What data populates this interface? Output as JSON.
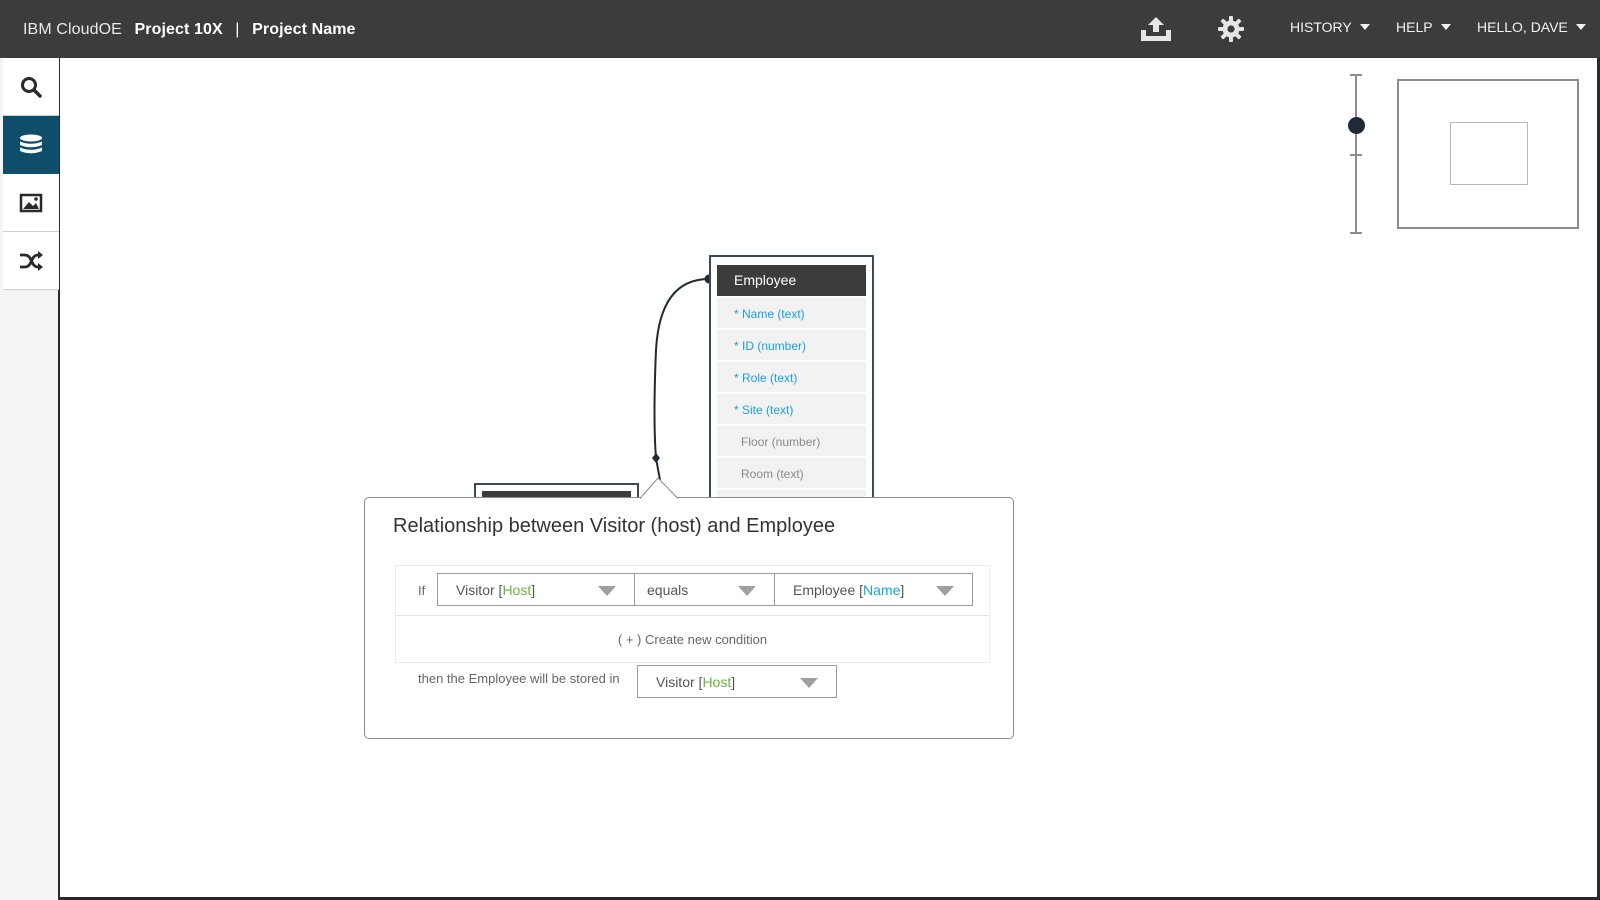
{
  "header": {
    "org": "IBM CloudOE",
    "project": "Project 10X",
    "separator": "|",
    "project_name": "Project Name",
    "upload_icon": "upload-icon",
    "settings_icon": "gear-icon",
    "menus": {
      "history": "HISTORY",
      "help": "HELP",
      "user": "HELLO, DAVE"
    }
  },
  "sidebar": {
    "items": [
      {
        "icon": "search-icon",
        "active": false
      },
      {
        "icon": "database-icon",
        "active": true
      },
      {
        "icon": "image-icon",
        "active": false
      },
      {
        "icon": "shuffle-icon",
        "active": false
      }
    ]
  },
  "entity": {
    "title": "Employee",
    "fields": [
      {
        "label": "* Name (text)",
        "required": true
      },
      {
        "label": "* ID (number)",
        "required": true
      },
      {
        "label": "* Role (text)",
        "required": true
      },
      {
        "label": "* Site (text)",
        "required": true
      },
      {
        "label": "Floor (number)",
        "required": false
      },
      {
        "label": "Room (text)",
        "required": false
      }
    ]
  },
  "zoom": {
    "level": 0.3
  },
  "dialog": {
    "title": "Relationship between Visitor (host) and Employee",
    "if_label": "If",
    "left_operand": {
      "entity": "Visitor",
      "field": "Host"
    },
    "operator": "equals",
    "right_operand": {
      "entity": "Employee",
      "field": "Name"
    },
    "new_condition": "( + ) Create new condition",
    "then_label": "then the Employee will be stored in",
    "target": {
      "entity": "Visitor",
      "field": "Host"
    }
  },
  "colors": {
    "topbar": "#3c3c3c",
    "active_sidebar": "#0f4e6a",
    "required_field": "#1aa1dc",
    "field_green": "#6cb33e"
  }
}
